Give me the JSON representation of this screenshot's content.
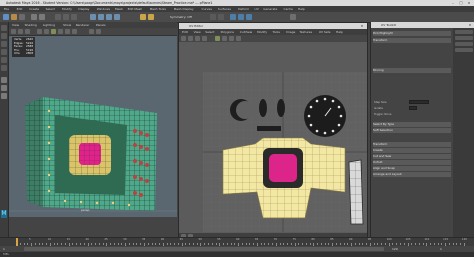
{
  "app": {
    "title": "Autodesk Maya 2016 - Student Version: C:\\Users\\saagr\\Documents\\maya\\projects\\default\\scenes\\Steam_Practice.ma* --- pPlane1"
  },
  "menubar": {
    "items": [
      "File",
      "Edit",
      "Create",
      "Select",
      "Modify",
      "Display",
      "Windows",
      "Mesh",
      "Edit Mesh",
      "Mesh Tools",
      "Mesh Display",
      "Curves",
      "Surfaces",
      "Deform",
      "UV",
      "Generate",
      "Cache",
      "Help"
    ]
  },
  "status": {
    "symmetry": "Symmetry: Off"
  },
  "viewport": {
    "menu": [
      "View",
      "Shading",
      "Lighting",
      "Show",
      "Renderer",
      "Panels"
    ],
    "hud_labels": [
      "Verts:",
      "Edges:",
      "Faces:",
      "Tris:",
      "UVs:"
    ],
    "hud_values": [
      "2640",
      "5226",
      "2588",
      "5196",
      "2808"
    ],
    "camera_label": "persp"
  },
  "uv_editor": {
    "title": "UV Editor",
    "menu": [
      "Edit",
      "View",
      "Select",
      "Polygons",
      "Cut/Sew",
      "Modify",
      "Tools",
      "Image",
      "Textures",
      "UV Sets",
      "Help"
    ]
  },
  "uv_toolkit": {
    "title": "UV Toolkit",
    "sections": [
      "Pick/Highlight",
      "Transform",
      "Pinning",
      "Select By Type",
      "Soft Selection",
      "Transform",
      "Create",
      "Cut and Sew",
      "Unfold",
      "Align and Snap",
      "Arrange and Layout"
    ],
    "fields": [
      "Step Size",
      "Isolate",
      "Toggle: None"
    ]
  },
  "timeline": {
    "start": "1",
    "end": "120",
    "current": "1",
    "labels": [
      "5",
      "10",
      "15",
      "20",
      "25",
      "30",
      "35",
      "40",
      "45",
      "50",
      "55",
      "60",
      "65",
      "70",
      "75",
      "80",
      "85",
      "90",
      "95",
      "100",
      "105",
      "110",
      "115",
      "120"
    ]
  },
  "commandline": {
    "label": "MEL"
  },
  "colors": {
    "screen_magenta": "#e0228a",
    "uv_yellow": "#f3e7a4",
    "tv_green": "#4fa88a"
  }
}
